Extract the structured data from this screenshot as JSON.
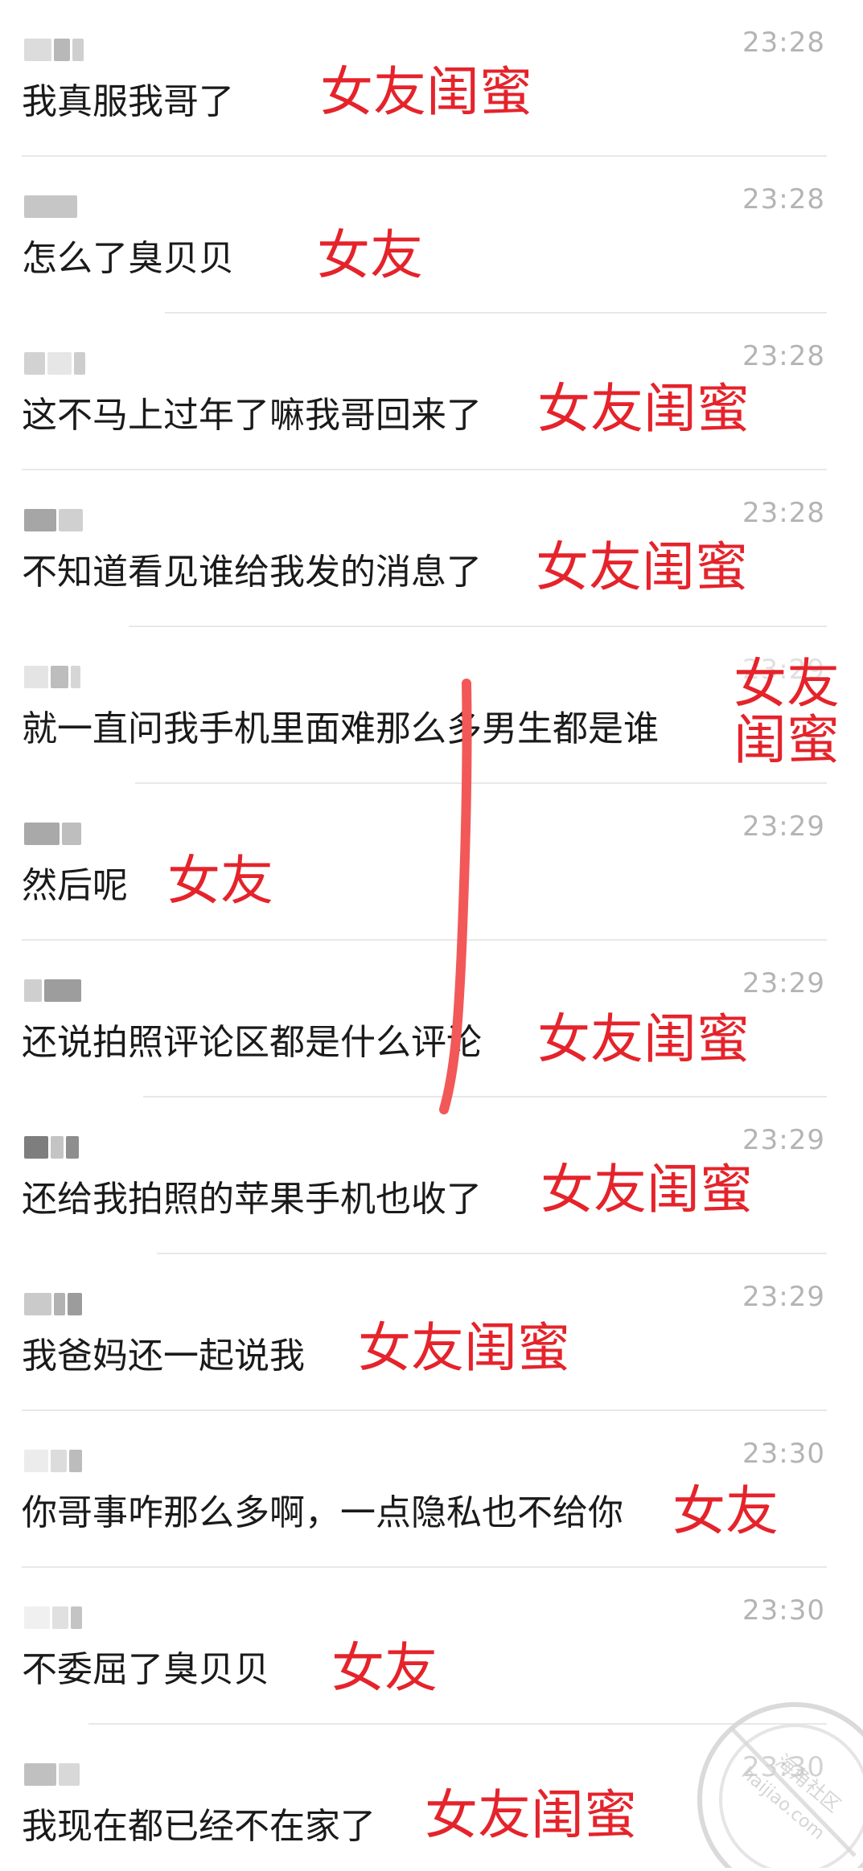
{
  "messages": [
    {
      "time": "23:28",
      "text": "我真服我哥了",
      "annotation": "女友闺蜜",
      "annotation2": ""
    },
    {
      "time": "23:28",
      "text": "怎么了臭贝贝",
      "annotation": "女友",
      "annotation2": ""
    },
    {
      "time": "23:28",
      "text": "这不马上过年了嘛我哥回来了",
      "annotation": "女友闺蜜",
      "annotation2": ""
    },
    {
      "time": "23:28",
      "text": "不知道看见谁给我发的消息了",
      "annotation": "女友闺蜜",
      "annotation2": ""
    },
    {
      "time": "23:29",
      "text": "就一直问我手机里面难那么多男生都是谁",
      "annotation": "女友",
      "annotation2": "闺蜜"
    },
    {
      "time": "23:29",
      "text": "然后呢",
      "annotation": "女友",
      "annotation2": ""
    },
    {
      "time": "23:29",
      "text": "还说拍照评论区都是什么评论",
      "annotation": "女友闺蜜",
      "annotation2": ""
    },
    {
      "time": "23:29",
      "text": "还给我拍照的苹果手机也收了",
      "annotation": "女友闺蜜",
      "annotation2": ""
    },
    {
      "time": "23:29",
      "text": "我爸妈还一起说我",
      "annotation": "女友闺蜜",
      "annotation2": ""
    },
    {
      "time": "23:30",
      "text": "你哥事咋那么多啊，一点隐私也不给你",
      "annotation": "女友",
      "annotation2": ""
    },
    {
      "time": "23:30",
      "text": "不委屈了臭贝贝",
      "annotation": "女友",
      "annotation2": ""
    },
    {
      "time": "23:30",
      "text": "我现在都已经不在家了",
      "annotation": "女友闺蜜",
      "annotation2": ""
    }
  ],
  "watermark": {
    "site": "haijiao.com",
    "label": "海角社区"
  },
  "colors": {
    "annotation": "#e5232b",
    "timestamp": "#b4b4b4",
    "text": "#1a1a1a",
    "divider": "#e8e8e8"
  }
}
